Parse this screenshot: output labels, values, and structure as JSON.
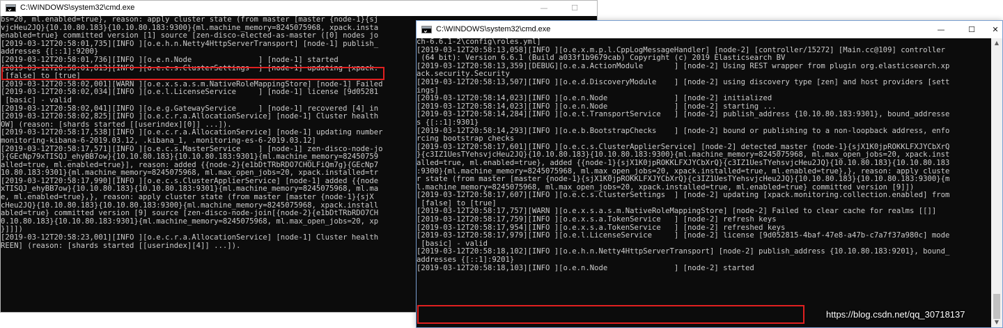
{
  "windows": [
    {
      "title": "C:\\WINDOWS\\system32\\cmd.exe",
      "controls": {
        "minimize": "—",
        "maximize": "☐",
        "close": "✕"
      },
      "lines": [
        "bs=20, ml.enabled=true}, reason: apply cluster state (from master [master {node-1}{sj",
        "vjcHeu2JQ}{10.10.80.183}{10.10.80.183:9300}{ml.machine_memory=8245075968, xpack.insta",
        "enabled=true} committed version [1] source [zen-disco-elected-as-master ([0] nodes jo",
        "[2019-03-12T20:58:01,735][INFO ][o.e.h.n.Netty4HttpServerTransport] [node-1] publish_",
        "addresses {[::1]:9200}",
        "[2019-03-12T20:58:01,736][INFO ][o.e.n.Node               ] [node-1] started",
        "[2019-03-12T20:58:01,813][INFO ][o.e.c.s.ClusterSettings  ] [node-1] updating [xpack.",
        " [false] to [true]",
        "[2019-03-12T20:58:02,001][WARN ][o.e.x.s.a.s.m.NativeRoleMappingStore] [node-1] Failed",
        "[2019-03-12T20:58:02,034][INFO ][o.e.l.LicenseService     ] [node-1] license [9d05281",
        " [basic] - valid",
        "[2019-03-12T20:58:02,041][INFO ][o.e.g.GatewayService     ] [node-1] recovered [4] in",
        "[2019-03-12T20:58:02,825][INFO ][o.e.c.r.a.AllocationService] [node-1] Cluster health",
        "OW] (reason: [shards started [[userindex][0]] ...]).",
        "[2019-03-12T20:58:17,538][INFO ][o.e.c.r.a.AllocationService] [node-1] updating number",
        "monitoring-kibana-6-2019.03.12, .kibana_1, .monitoring-es-6-2019.03.12]",
        "[2019-03-12T20:58:17,571][INFO ][o.e.c.s.MasterService    ] [node-1] zen-disco-node-jo",
        "}{GEcNp79xTISQJ_ehyBB7ow}{10.10.80.183}{10.10.80.183:9301}{ml.machine_memory=82450759",
        "alled=true, ml.enabled=true}], reason: added {{node-2}{e1bDtTRbRDO7CHOLFiQm7g}{GEcNp7",
        "10.80.183:9301}{ml.machine_memory=8245075968, ml.max_open_jobs=20, xpack.installed=tr",
        "[2019-03-12T20:58:17,990][INFO ][o.e.c.s.ClusterApplierService] [node-1] added {{node",
        "xTISQJ_ehyBB7ow}{10.10.80.183}{10.10.80.183:9301}{ml.machine_memory=8245075968, ml.ma",
        "e, ml.enabled=true},}, reason: apply cluster state (from master [master {node-1}{sjX",
        "cHeu2JQ}{10.10.80.183}{10.10.80.183:9300}{ml.machine_memory=8245075968, xpack.install",
        "abled=true} committed version [9] source [zen-disco-node-join[{node-2}{e1bDtTRbRDO7CH",
        "0.10.80.183}{10.10.80.183:9301}{ml.machine_memory=8245075968, ml.max_open_jobs=20, xp",
        "}]]])",
        "[2019-03-12T20:58:23,001][INFO ][o.e.c.r.a.AllocationService] [node-1] Cluster health",
        "REEN] (reason: [shards started [[userindex][4]] ...])."
      ]
    },
    {
      "title": "C:\\WINDOWS\\system32\\cmd.exe",
      "controls": {
        "minimize": "—",
        "maximize": "☐",
        "close": "✕"
      },
      "lines": [
        "ch-6.6.1-2\\config\\roles.yml]",
        "[2019-03-12T20:58:13,058][INFO ][o.e.x.m.p.l.CppLogMessageHandler] [node-2] [controller/15272] [Main.cc@109] controller",
        " (64 bit): Version 6.6.1 (Build a033f1b9679cab) Copyright (c) 2019 Elasticsearch BV",
        "[2019-03-12T20:58:13,359][DEBUG][o.e.a.ActionModule       ] [node-2] Using REST wrapper from plugin org.elasticsearch.xp",
        "ack.security.Security",
        "[2019-03-12T20:58:13,507][INFO ][o.e.d.DiscoveryModule    ] [node-2] using discovery type [zen] and host providers [sett",
        "ings]",
        "[2019-03-12T20:58:14,023][INFO ][o.e.n.Node               ] [node-2] initialized",
        "[2019-03-12T20:58:14,023][INFO ][o.e.n.Node               ] [node-2] starting ...",
        "[2019-03-12T20:58:14,284][INFO ][o.e.t.TransportService   ] [node-2] publish_address {10.10.80.183:9301}, bound_addresse",
        "s {[::1]:9301}",
        "[2019-03-12T20:58:14,293][INFO ][o.e.b.BootstrapChecks    ] [node-2] bound or publishing to a non-loopback address, enfo",
        "rcing bootstrap checks",
        "[2019-03-12T20:58:17,601][INFO ][o.e.c.s.ClusterApplierService] [node-2] detected_master {node-1}{sjX1K0jpROKKLFXJYCbXrQ",
        "}{c3IZ1UesTYehsvjcHeu2JQ}{10.10.80.183}{10.10.80.183:9300}{ml.machine_memory=8245075968, ml.max_open_jobs=20, xpack.inst",
        "alled=true, ml.enabled=true}, added {{node-1}{sjX1K0jpROKKLFXJYCbXrQ}{c3IZ1UesTYehsvjcHeu2JQ}{10.10.80.183}{10.10.80.183",
        ":9300}{ml.machine_memory=8245075968, ml.max_open_jobs=20, xpack.installed=true, ml.enabled=true},}, reason: apply cluste",
        "r state (from master [master {node-1}{sjX1K0jpROKKLFXJYCbXrQ}{c3IZ1UesTYehsvjcHeu2JQ}{10.10.80.183}{10.10.80.183:9300}{m",
        "l.machine_memory=8245075968, ml.max_open_jobs=20, xpack.installed=true, ml.enabled=true} committed version [9]])",
        "[2019-03-12T20:58:17,607][INFO ][o.e.c.s.ClusterSettings  ] [node-2] updating [xpack.monitoring.collection.enabled] from",
        " [false] to [true]",
        "[2019-03-12T20:58:17,757][WARN ][o.e.x.s.a.s.m.NativeRoleMappingStore] [node-2] Failed to clear cache for realms [[]]",
        "[2019-03-12T20:58:17,759][INFO ][o.e.x.s.a.TokenService   ] [node-2] refresh keys",
        "[2019-03-12T20:58:17,954][INFO ][o.e.x.s.a.TokenService   ] [node-2] refreshed keys",
        "[2019-03-12T20:58:17,979][INFO ][o.e.l.LicenseService     ] [node-2] license [9d052815-4baf-47e8-a47b-c7a7f37a980c] mode",
        " [basic] - valid",
        "[2019-03-12T20:58:18,102][INFO ][o.e.h.n.Netty4HttpServerTransport] [node-2] publish_address {10.10.80.183:9201}, bound_",
        "addresses {[::1]:9201}",
        "[2019-03-12T20:58:18,103][INFO ][o.e.n.Node               ] [node-2] started"
      ]
    }
  ],
  "watermark": "https://blog.csdn.net/qq_30718137",
  "highlight_color": "#e02020"
}
